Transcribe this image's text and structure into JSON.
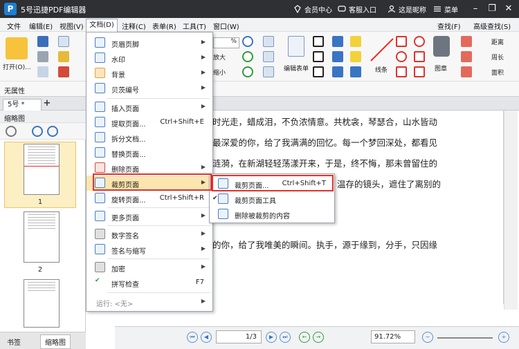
{
  "titlebar": {
    "title": "5号迅捷PDF编辑器",
    "member": "会员中心",
    "service": "客服入口",
    "user": "这是昵称",
    "menu": "菜单"
  },
  "menubar": {
    "items": [
      "文件",
      "编辑(E)",
      "视图(V)",
      "文档(D)",
      "注释(C)",
      "表单(R)",
      "工具(T)",
      "窗口(W)"
    ],
    "find": "查找(F)",
    "advanced_find": "高级查找(S)"
  },
  "ribbon": {
    "open": "打开(O)...",
    "zoom_value": "%",
    "enlarge": "放大",
    "shrink": "缩小",
    "edit_form": "编辑表单",
    "lines": "线条",
    "stamp": "图章",
    "distance": "距离",
    "perimeter": "周长",
    "area": "面积"
  },
  "attrbar": {
    "label": "无属性"
  },
  "tabs": {
    "doc_tab": "5号 *"
  },
  "sidepanel": {
    "title": "缩略图",
    "thumb1": "1",
    "thumb2": "2",
    "tab_bookmark": "书签",
    "tab_thumbnail": "缩略图"
  },
  "document": {
    "lines": [
      "时光走，蜡成泪，不负浓情意。共枕衾，琴瑟合，山水皆动",
      "最深爱的你，给了我满满的回忆。每一个梦回深处，都看见",
      "涟漪，在新湖轻轻荡漾开来，于是，终不悔，那未曾留住的",
      "温存的镜头，遮住了离别的",
      "的你，给了我唯美的瞬间。执手，源于缘到，分手，只因缘"
    ]
  },
  "statusbar": {
    "page": "1/3",
    "zoom": "91.72%"
  },
  "doc_menu": {
    "items": [
      {
        "label": "页眉页脚",
        "arrow": true
      },
      {
        "label": "水印",
        "arrow": true
      },
      {
        "label": "背景",
        "arrow": true
      },
      {
        "label": "贝茨编号",
        "arrow": true
      },
      {
        "label": "插入页面",
        "arrow": true
      },
      {
        "label": "提取页面...",
        "shortcut": "Ctrl+Shift+E"
      },
      {
        "label": "拆分文档..."
      },
      {
        "label": "替换页面..."
      },
      {
        "label": "删除页面",
        "arrow": true
      },
      {
        "label": "裁剪页面",
        "arrow": true
      },
      {
        "label": "旋转页面...",
        "shortcut": "Ctrl+Shift+R"
      },
      {
        "label": "更多页面",
        "arrow": true
      },
      {
        "label": "数字签名",
        "arrow": true
      },
      {
        "label": "签名与缩写",
        "arrow": true
      },
      {
        "label": "加密",
        "arrow": true
      },
      {
        "label": "拼写检查",
        "shortcut": "F7"
      },
      {
        "label": "运行: <无>",
        "arrow": true
      }
    ]
  },
  "crop_submenu": {
    "items": [
      {
        "label": "裁剪页面...",
        "shortcut": "Ctrl+Shift+T"
      },
      {
        "label": "裁剪页面工具"
      },
      {
        "label": "删除被裁剪的内容"
      }
    ]
  },
  "colors": {
    "accent": "#1e7ed8",
    "highlight": "#fde6ae",
    "callout": "#e0312d",
    "titlebar": "#2f3033"
  }
}
